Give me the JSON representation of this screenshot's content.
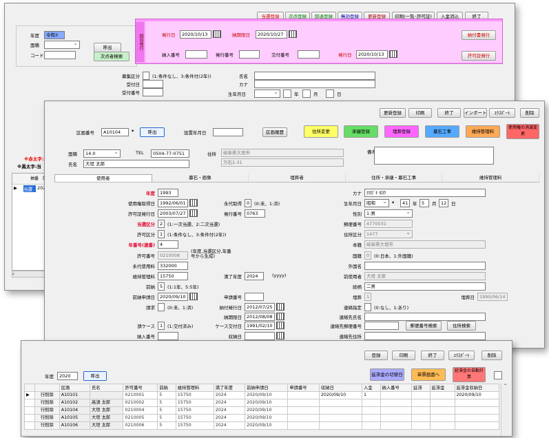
{
  "w1": {
    "toolbar": [
      "当選登録",
      "次点登録",
      "辞退登録",
      "無効登録",
      "更新登録",
      "印刷(一覧･許可証)",
      "入金消込",
      "終了"
    ],
    "year_label": "年度",
    "year_value": "令和3",
    "area_label": "面積",
    "code_label": "コード",
    "call_btn": "呼出",
    "next_btn": "次点者検索",
    "print_side_label": "個別発行",
    "issue_date_label": "発行日",
    "issue_date": "2020/10/13",
    "deadline_label": "納期限日",
    "deadline": "2020/10/27",
    "notice_btn": "納付書発行",
    "payno_label": "納入番号",
    "issueno_label": "発行番号",
    "receiptno_label": "交付番号",
    "issue_date2_label": "発行日",
    "issue_date2": "2020/10/13",
    "permit_btn": "許可証発行",
    "apply_type_label": "募集区分",
    "apply_type_hint": "(1:条件なし、3:条件付(2年))",
    "accept_date_label": "受付日",
    "accept_no_label": "受付番号",
    "name_label": "氏名",
    "kana_label": "カナ",
    "birth_label": "生年月日",
    "birth_year": "年",
    "birth_month": "月",
    "birth_day": "日",
    "note_red": "※赤太字:当",
    "note_bold": "※黒太字:当",
    "grid_headers": [
      "抽番",
      "許行"
    ],
    "grid_row": [
      "当選",
      "202"
    ]
  },
  "w2": {
    "toolbar": [
      "更新登録",
      "印刷",
      "終了",
      "インポート",
      "ｴｸｽﾎﾟｰﾄ",
      "削除"
    ],
    "block_label": "区画番号",
    "block_value": "A10104",
    "call_btn": "呼出",
    "setup_year_label": "設置年月日",
    "history_btn": "区画履歴",
    "color_btns": [
      "住所変更",
      "承継登録",
      "埋葬登録",
      "墓石工事",
      "維持管理料",
      "使用権の消滅変更"
    ],
    "color_btn_colors": [
      "#ffff66",
      "#66dd66",
      "#ff66ff",
      "#55aaff",
      "#ffaa55",
      "#ff6666"
    ],
    "area_label": "面積",
    "area_value": "14.0",
    "tel_label": "TEL",
    "tel_value": "0504-77-0751",
    "addr_label": "住所",
    "addr1": "岐阜県大垣市",
    "addr2": "万石2-31",
    "remarks_label": "備考",
    "name_label": "氏名",
    "name_value": "大垣 太郎",
    "tabs": [
      "使用者",
      "墓石・画像",
      "埋葬者",
      "住所・承継・墓石工事",
      "維持管理料"
    ],
    "left": {
      "year_label": "年度",
      "year_value": "1993",
      "use_acq_label": "使用権取得日",
      "use_acq": "1992/06/01",
      "permit_issue_label": "許可証発行日",
      "permit_issue": "2003/07/27",
      "win_type_label": "当選区分",
      "win_type": "2",
      "win_type_hint": "(1:一次当選、2:二次当選)",
      "permit_type_label": "許可区分",
      "permit_type": "1",
      "permit_type_hint": "(1:条件なし、3:条件付(2年))",
      "year_no_label": "年番号(連番)",
      "year_no": "4",
      "permit_no_label": "許可番号",
      "permit_no": "0210008",
      "permit_no_hint": "(年度,当選区分,年番号から生成)",
      "perm_fee_label": "永代使用料",
      "perm_fee": "332000",
      "maint_fee_label": "維持管理料",
      "maint_fee": "15750",
      "expire_label": "満了年度",
      "expire": "2024",
      "expire_hint": "(yyyy)",
      "prepay_label": "前納",
      "prepay": "5",
      "prepay_hint": "(1:1年、5:5年)",
      "prepay_date_label": "前納申請日",
      "prepay_date": "2020/09/10",
      "apply_no_label": "申請番号",
      "claim_label": "請求",
      "claim_hint": "(0:未、1:済)",
      "pay_issue_label": "納付発行日",
      "pay_issue": "2012/07/25",
      "perm_label": "永代取得",
      "perm": "0",
      "perm_hint": "(0:未、1:済)",
      "issue_no_label": "発行番号",
      "issue_no": "0763",
      "pay_deadline_label": "納期限日",
      "pay_deadline": "2012/08/08",
      "case_label": "請ケース",
      "case": "1",
      "case_hint": "(1:交付済み)",
      "case_issue_label": "ケース交付日",
      "case_issue": "1991/02/10",
      "payin_label": "納入番号",
      "receipt_label": "収納日"
    },
    "right": {
      "kana_label": "カナ",
      "kana": "ｵｵｶﾞｷ ﾀﾛｳ",
      "birth_label": "生年月日",
      "era": "昭和",
      "by": "41",
      "bm": "5",
      "bd": "12",
      "y": "年",
      "m": "月",
      "d": "日",
      "sex_label": "性別",
      "sex": "1:男",
      "zip_label": "郵便番号",
      "zip": "4770031",
      "res_label": "住所区分",
      "res": "1477",
      "domicile_label": "本籍",
      "domicile": "岐阜県大垣市",
      "nation_label": "国籍",
      "nation": "0",
      "nation_hint": "(0:日本、1:外国籍)",
      "foreign_label": "外国名",
      "prev_user_label": "前使用者",
      "prev_user": "大垣 太郎",
      "relation_label": "続柄",
      "relation": "二男",
      "burial_label": "埋葬",
      "burial": "1",
      "burial_date_label": "埋葬日",
      "burial_date": "1990/06/14",
      "contact_label": "連絡指定",
      "contact_hint": "(0:なし、1:あり)",
      "contact_name_label": "連絡先氏名",
      "contact_zip_label": "連絡先郵便番号",
      "zip_search_btn": "郵便番号検索",
      "addr_search_btn": "住所検索",
      "contact_addr_label": "連絡先住所"
    }
  },
  "w3": {
    "toolbar": [
      "登録",
      "印刷",
      "終了",
      "ｴｸｽﾎﾟｰﾄ",
      "削除"
    ],
    "year_label": "年度",
    "year_value": "2020",
    "call_btn": "呼出",
    "color_btns": [
      "延滞金の切替日",
      "単票画面へ",
      "延滞金の自動計算"
    ],
    "color_btn_colors": [
      "#aaaaff",
      "#ffbb55",
      "#ff7777"
    ],
    "headers": [
      "",
      "",
      "区画",
      "氏名",
      "許可番号",
      "前納",
      "維持管理料",
      "満了年度",
      "前納申請日",
      "申請番号",
      "収納日",
      "入金",
      "納入番号",
      "延滞",
      "延滞金",
      "延滞金収納日"
    ],
    "rows": [
      [
        "▶",
        "行削除",
        "A10101",
        "",
        "0210001",
        "5",
        "15750",
        "2024",
        "2020/09/10",
        "",
        "2020/09/10",
        "1",
        "",
        "",
        "",
        "2020/09/10"
      ],
      [
        "",
        "行削除",
        "A10102",
        "高須 太郎",
        "0210002",
        "5",
        "15750",
        "2024",
        "2020/09/10",
        "",
        "",
        "",
        "",
        "",
        "",
        ""
      ],
      [
        "",
        "行削除",
        "A10104",
        "大垣 太郎",
        "0210004",
        "5",
        "15750",
        "2024",
        "2020/09/10",
        "",
        "",
        "",
        "",
        "",
        "",
        ""
      ],
      [
        "",
        "行削除",
        "A10105",
        "大垣 太郎",
        "0210005",
        "5",
        "15750",
        "2024",
        "2020/09/10",
        "",
        "",
        "",
        "",
        "",
        "",
        ""
      ],
      [
        "",
        "行削除",
        "A10106",
        "大垣 太郎",
        "0210006",
        "5",
        "15750",
        "2024",
        "2020/09/10",
        "",
        "",
        "",
        "",
        "",
        "",
        ""
      ]
    ]
  }
}
